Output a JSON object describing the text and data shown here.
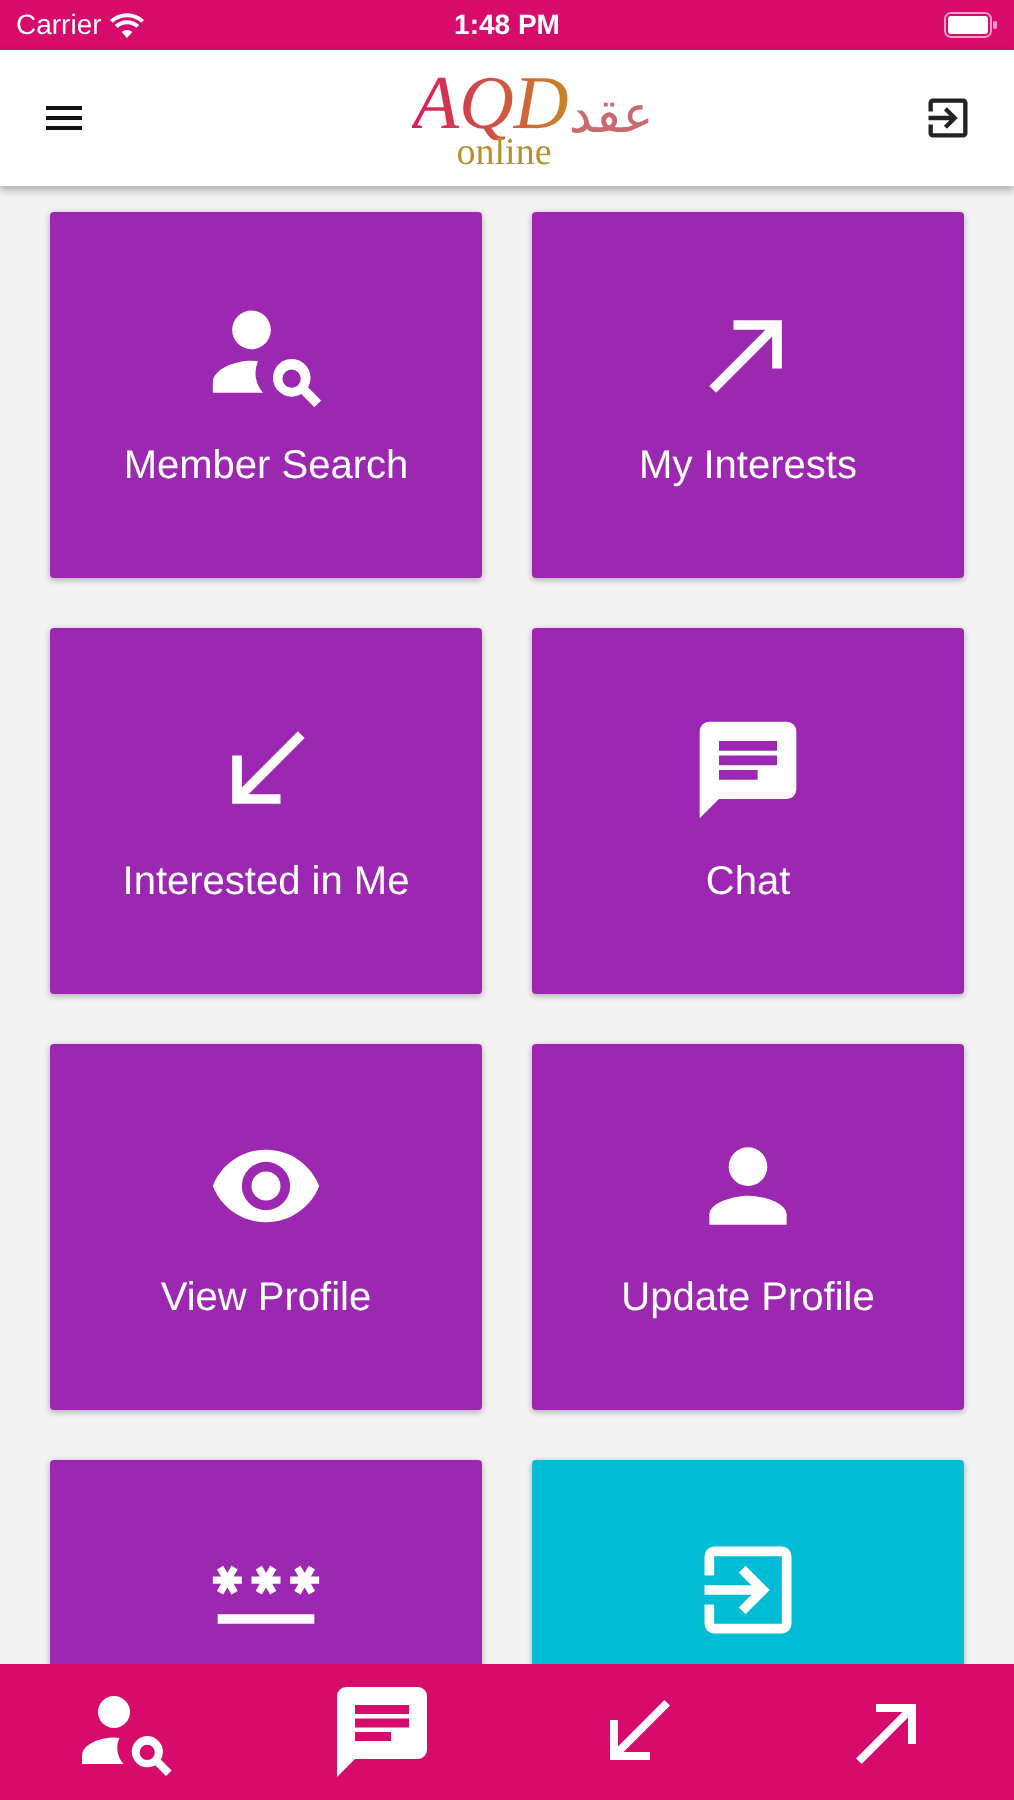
{
  "status_bar": {
    "carrier": "Carrier",
    "time": "1:48 PM"
  },
  "header": {
    "logo": {
      "latin": "AQD",
      "arabic": "عقد",
      "subtitle": "online"
    }
  },
  "tiles": [
    {
      "label": "Member Search",
      "color": "#9c27b0"
    },
    {
      "label": "My Interests",
      "color": "#9c27b0"
    },
    {
      "label": "Interested in Me",
      "color": "#9c27b0"
    },
    {
      "label": "Chat",
      "color": "#9c27b0"
    },
    {
      "label": "View Profile",
      "color": "#9c27b0"
    },
    {
      "label": "Update Profile",
      "color": "#9c27b0"
    },
    {
      "color": "#9c27b0"
    },
    {
      "color": "#00bcd4"
    }
  ]
}
